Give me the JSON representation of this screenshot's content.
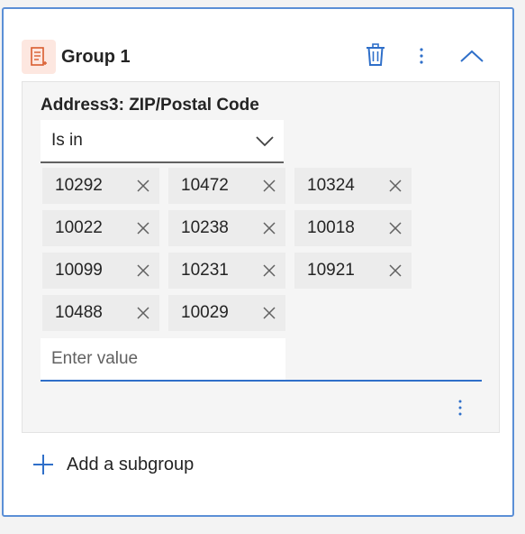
{
  "group": {
    "title": "Group 1"
  },
  "condition": {
    "field_label": "Address3: ZIP/Postal Code",
    "operator": "Is in",
    "values": [
      "10292",
      "10472",
      "10324",
      "10022",
      "10238",
      "10018",
      "10099",
      "10231",
      "10921",
      "10488",
      "10029"
    ],
    "input_placeholder": "Enter value"
  },
  "footer": {
    "add_subgroup_label": "Add a subgroup"
  },
  "colors": {
    "accent": "#2f6fc9",
    "card_border": "#5b8fd6",
    "group_icon_bg": "#fde7e0",
    "group_icon_fg": "#d95c2e"
  }
}
